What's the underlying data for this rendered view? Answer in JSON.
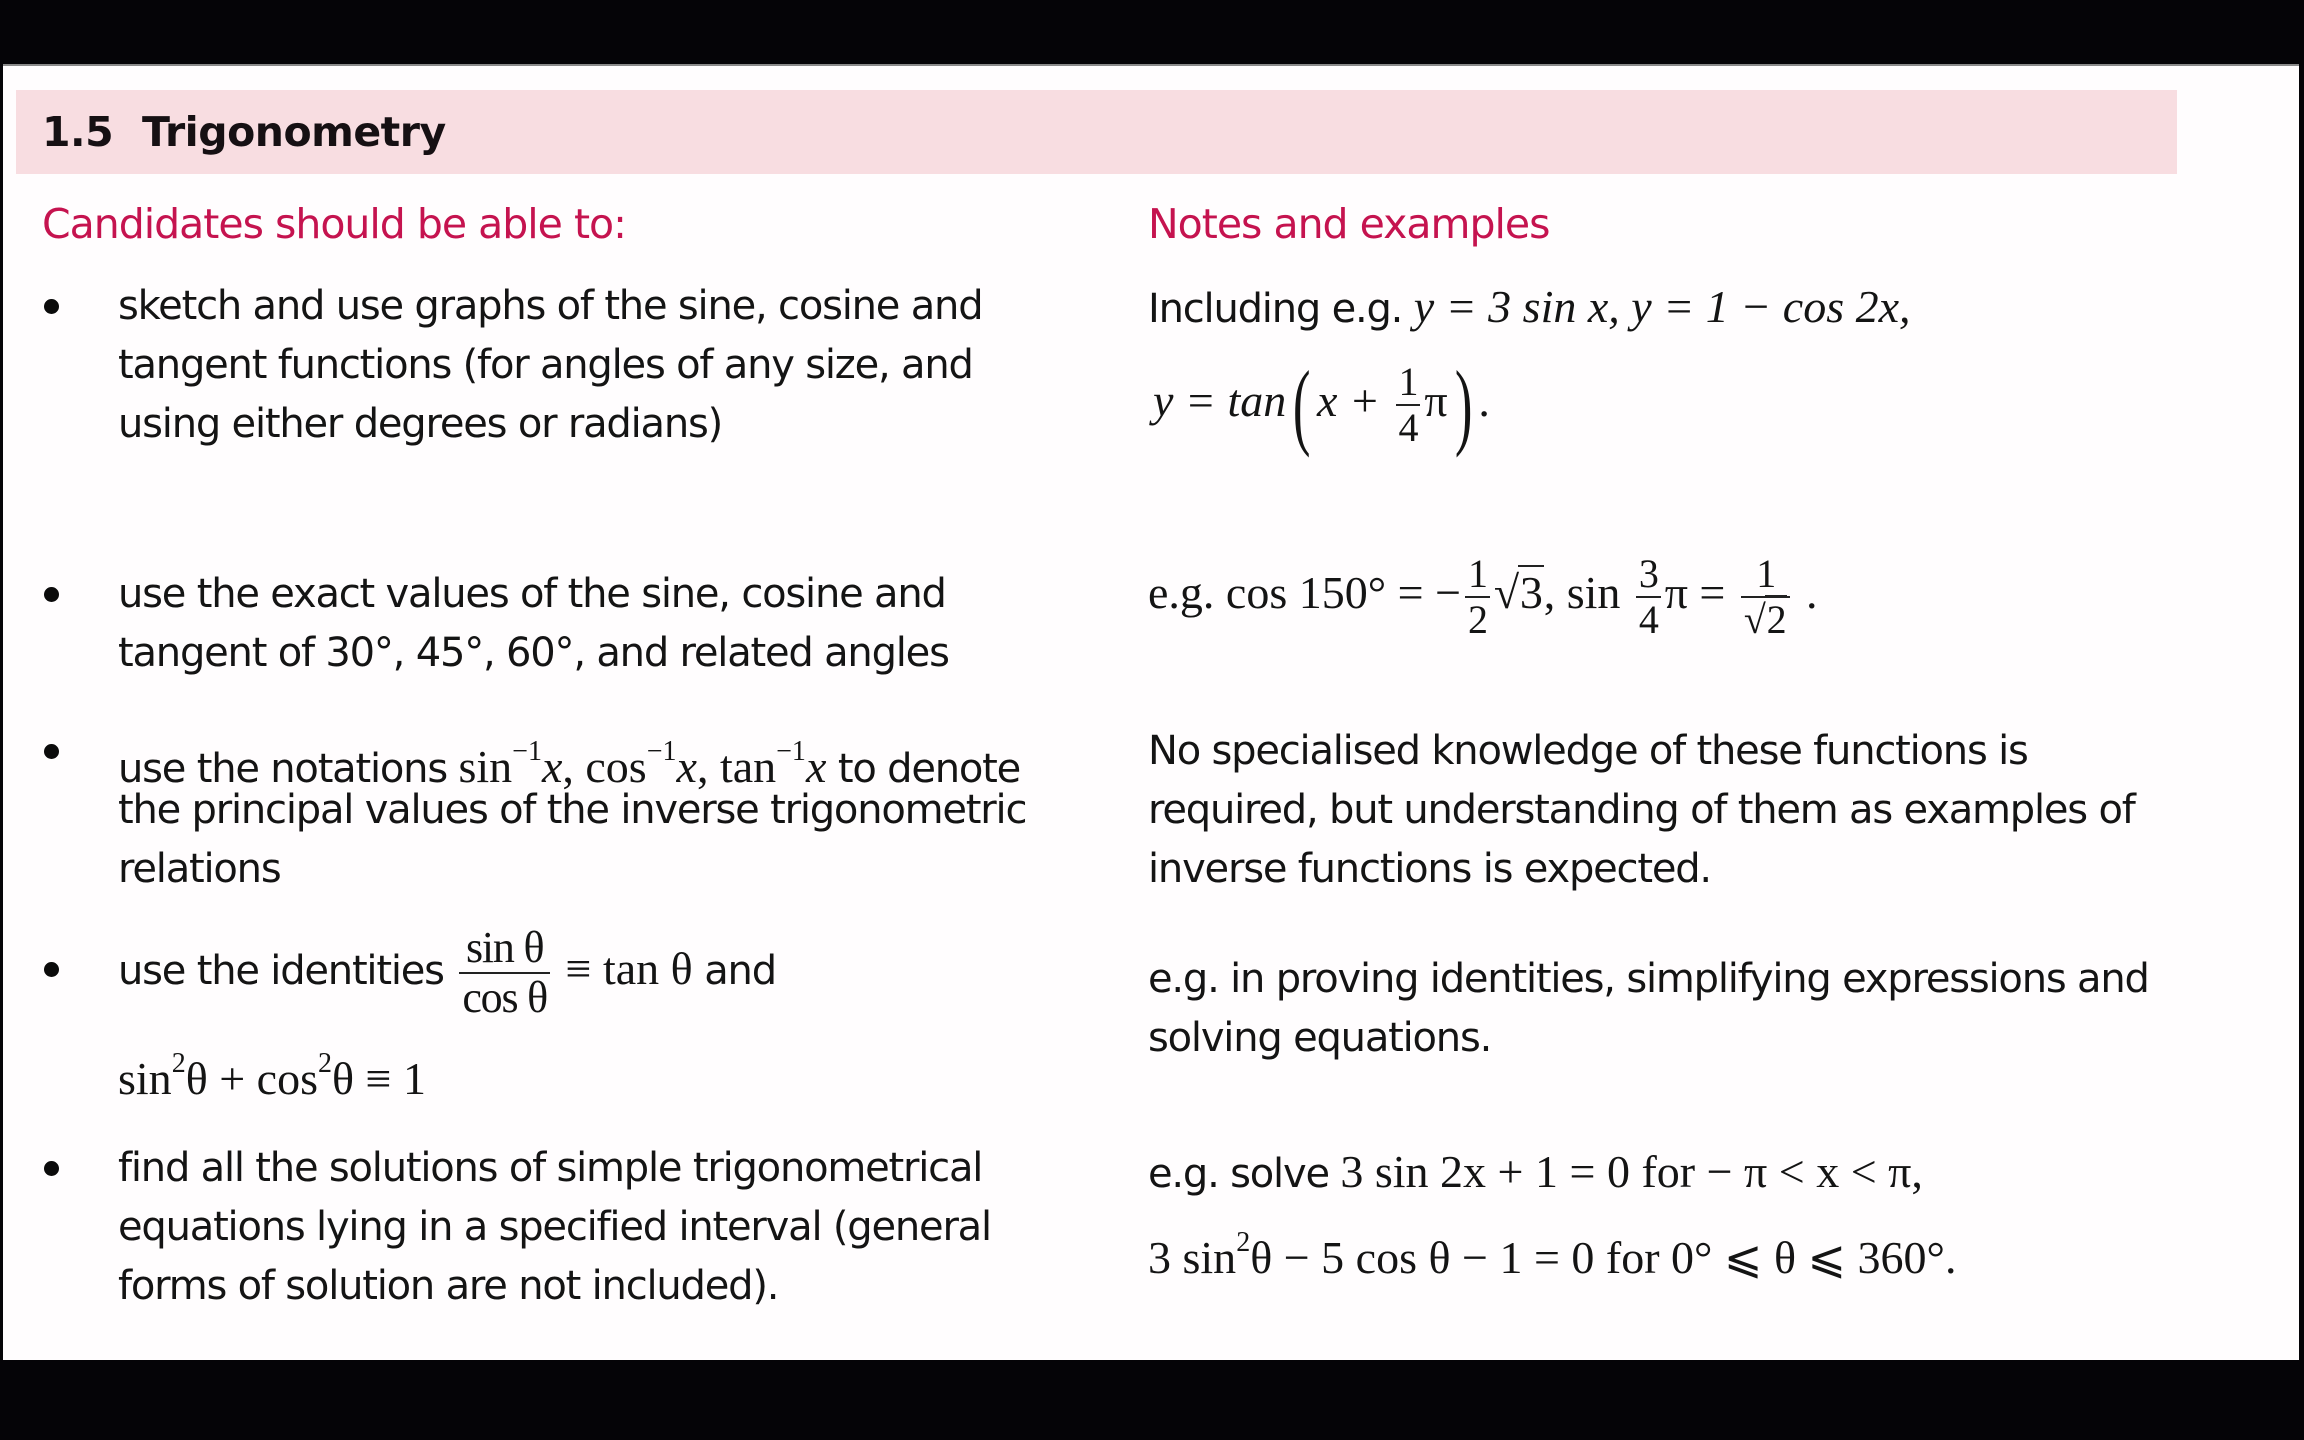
{
  "section": {
    "number": "1.5",
    "title": "Trigonometry"
  },
  "columns": {
    "left_heading": "Candidates should be able to:",
    "right_heading": "Notes and examples"
  },
  "colors": {
    "heading_accent": "#c5134f",
    "band_background": "#f8dde1"
  },
  "objectives": [
    {
      "lines": [
        "sketch and use graphs of the sine, cosine and",
        "tangent functions (for angles of any size, and",
        "using either degrees or radians)"
      ]
    },
    {
      "lines": [
        "use the exact values of the sine, cosine and",
        "tangent of 30°, 45°, 60°, and related angles"
      ]
    },
    {
      "prefix": "use the notations ",
      "f1": "sin",
      "f2": "cos",
      "f3": "tan",
      "inv": "−1",
      "var": "x",
      "sep": ", ",
      "suffix": " to denote",
      "lines": [
        "the principal values of the inverse trigonometric",
        "relations"
      ]
    },
    {
      "prefix": "use the identities ",
      "frac_top": "sin θ",
      "frac_bot": "cos θ",
      "equiv": " ≡ tan θ",
      "suffix": " and",
      "line2_a": "sin",
      "sq": "2",
      "line2_b": "θ + cos",
      "line2_c": "θ ≡ 1"
    },
    {
      "lines": [
        "find all the solutions of simple trigonometrical",
        "equations lying in a specified interval (general",
        "forms of solution are not included)."
      ]
    }
  ],
  "notes": [
    {
      "prefix": "Including e.g. ",
      "eq1": "y = 3 sin x, y = 1 − cos 2x,",
      "eq2_a": "y = tan",
      "eq2_x": "x + ",
      "frac_top": "1",
      "frac_bot": "4",
      "pi": "π",
      "end": "."
    },
    {
      "prefix": "e.g. ",
      "a": "cos 150° = −",
      "f1_top": "1",
      "f1_bot": "2",
      "root1": "3",
      "b": ", sin ",
      "f2_top": "3",
      "f2_bot": "4",
      "c": "π = ",
      "f3_top": "1",
      "root3": "2",
      "end": " ."
    },
    {
      "lines": [
        "No specialised knowledge of these functions is",
        "required, but understanding of them as examples of",
        "inverse functions is expected."
      ]
    },
    {
      "lines": [
        "e.g. in proving identities, simplifying expressions and",
        "solving equations."
      ]
    },
    {
      "prefix": "e.g. solve ",
      "eq1": "3 sin 2x + 1 = 0 for − π < x < π,",
      "eq2_a": "3 sin",
      "sq": "2",
      "eq2_b": "θ − 5 cos θ − 1 = 0 for 0° ⩽ θ ⩽ 360°."
    }
  ]
}
